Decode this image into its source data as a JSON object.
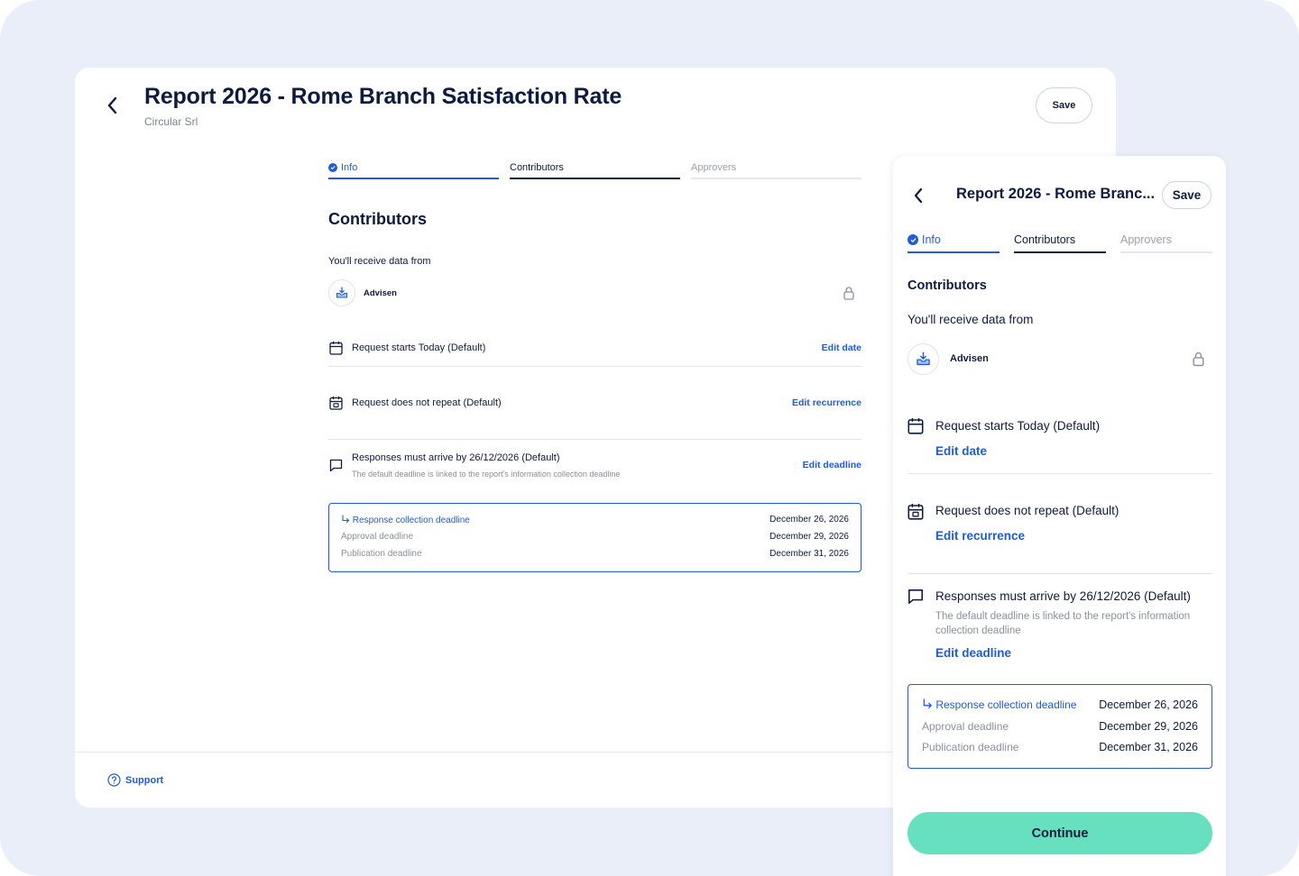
{
  "report": {
    "title": "Report 2026 - Rome Branch Satisfaction Rate",
    "title_truncated": "Report 2026 - Rome Branc...",
    "organization": "Circular Srl",
    "save_label": "Save"
  },
  "tabs": [
    {
      "label": "Info",
      "state": "completed"
    },
    {
      "label": "Contributors",
      "state": "active"
    },
    {
      "label": "Approvers",
      "state": "upcoming"
    }
  ],
  "contributors": {
    "heading": "Contributors",
    "receive_label": "You'll receive data from",
    "source_name": "Advisen",
    "start_row": {
      "text": "Request starts Today (Default)",
      "action": "Edit date"
    },
    "repeat_row": {
      "text": "Request does not repeat (Default)",
      "action": "Edit recurrence"
    },
    "deadline_row": {
      "text": "Responses must arrive by 26/12/2026 (Default)",
      "note": "The default deadline is linked to the report's information collection deadline",
      "action": "Edit deadline"
    },
    "deadlines": [
      {
        "label": "Response collection deadline",
        "date": "December 26, 2026",
        "primary": true
      },
      {
        "label": "Approval deadline",
        "date": "December 29, 2026",
        "primary": false
      },
      {
        "label": "Publication deadline",
        "date": "December 31, 2026",
        "primary": false
      }
    ]
  },
  "footer": {
    "support_label": "Support"
  },
  "mobile": {
    "continue_label": "Continue"
  },
  "colors": {
    "accent": "#1f5cd6",
    "text": "#0d1b3e",
    "continue": "#66e0bf",
    "background": "#e9eef8"
  }
}
